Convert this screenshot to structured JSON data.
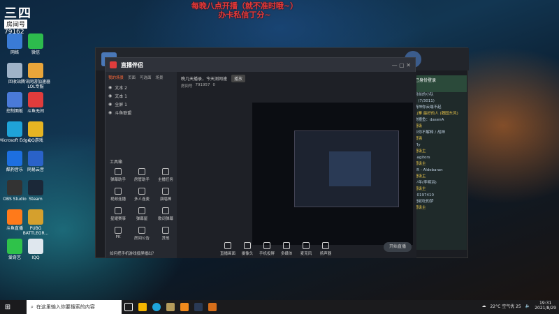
{
  "banner": {
    "line1": "每晚八点开播（就不准时哦~）",
    "line2": "办卡私信丁分~"
  },
  "logo": {
    "big": "三四",
    "room": "房间号",
    "num": "79162"
  },
  "desktop_icons": [
    {
      "label": "网络",
      "color": "#3a7bd5"
    },
    {
      "label": "微信",
      "color": "#2dbb4d"
    },
    {
      "label": "回收站",
      "color": "#9fb3c8"
    },
    {
      "label": "腾讯网游加速器LOL专服",
      "color": "#e8a53a"
    },
    {
      "label": "控制面板",
      "color": "#4a7ad8"
    },
    {
      "label": "斗鱼无间",
      "color": "#e03c3c"
    },
    {
      "label": "Microsoft Edge",
      "color": "#1fa3d8"
    },
    {
      "label": "QQ游戏",
      "color": "#e6b422"
    },
    {
      "label": "酷狗音乐",
      "color": "#1d6fe0"
    },
    {
      "label": "网易云音",
      "color": "#2a62c8"
    },
    {
      "label": "OBS Studio",
      "color": "#333"
    },
    {
      "label": "Steam",
      "color": "#1b2838"
    },
    {
      "label": "斗鱼直播",
      "color": "#ff7a1a"
    },
    {
      "label": "PUBG BATTLEGR...",
      "color": "#d5a02d"
    },
    {
      "label": "爱奇艺",
      "color": "#2fc24a"
    },
    {
      "label": "IQQ",
      "color": "#dfe7ee"
    }
  ],
  "app": {
    "title": "直播伴侣",
    "tabs": [
      "我的场景",
      "页面",
      "可选面",
      "场景"
    ],
    "scenes": [
      "文本 2",
      "文本 1",
      "全屏 1",
      "斗鱼联盟"
    ],
    "notice": "晚几天播录，今天测网速",
    "notice_btn": "播放",
    "room_label": "房间号",
    "room_id": "791957",
    "view_count": "0",
    "tools_title": "工具箱",
    "tools": [
      "弹幕助手",
      "房管助手",
      "主播任务",
      "视频连播",
      "多人连麦",
      "演唱棒",
      "星耀赛事",
      "弹幕屋",
      "歌词弹幕",
      "PK",
      "房间公告",
      "其他"
    ],
    "bottom": [
      "直播画面",
      "摄像头",
      "手机投屏",
      "多媒体",
      "麦克风",
      "扬声器"
    ],
    "start_btn": "开始直播",
    "status": "如何把手机游戏投屏播出？"
  },
  "chat": {
    "header": "已身份登录",
    "lines": [
      {
        "t": "粉丝的小队",
        "y": false
      },
      {
        "t": "3 (7/3011)",
        "y": false
      },
      {
        "t": "晴神你云端不起",
        "y": false
      },
      {
        "t": "山寨 最好的人 (魏国东风)",
        "y": true
      },
      {
        "t": "美瞳鱼：dasenA",
        "y": false
      },
      {
        "t": "超级",
        "y": true
      },
      {
        "t": "纱你不解释 / 战神",
        "y": false
      },
      {
        "t": "超强",
        "y": true
      },
      {
        "t": "ffly",
        "y": false
      },
      {
        "t": "超级主",
        "y": true
      },
      {
        "t": "Sagitors",
        "y": false
      },
      {
        "t": "超级主",
        "y": true
      },
      {
        "t": "FR - Aldebaran",
        "y": false
      },
      {
        "t": "超级主",
        "y": true
      },
      {
        "t": "少年(李明羽)",
        "y": false
      },
      {
        "t": "超级主",
        "y": true
      },
      {
        "t": "20197410",
        "y": false
      },
      {
        "t": "蚂蚁吃的梦",
        "y": false
      },
      {
        "t": "超级主",
        "y": true
      }
    ]
  },
  "taskbar": {
    "search_placeholder": "在这里输入你要搜索的内容",
    "weather": "22°C 空气优 25",
    "time": "19:31",
    "date": "2021/8/29"
  },
  "colors": {
    "red_banner": "#e23a3a",
    "accent": "#2dbb4d"
  }
}
